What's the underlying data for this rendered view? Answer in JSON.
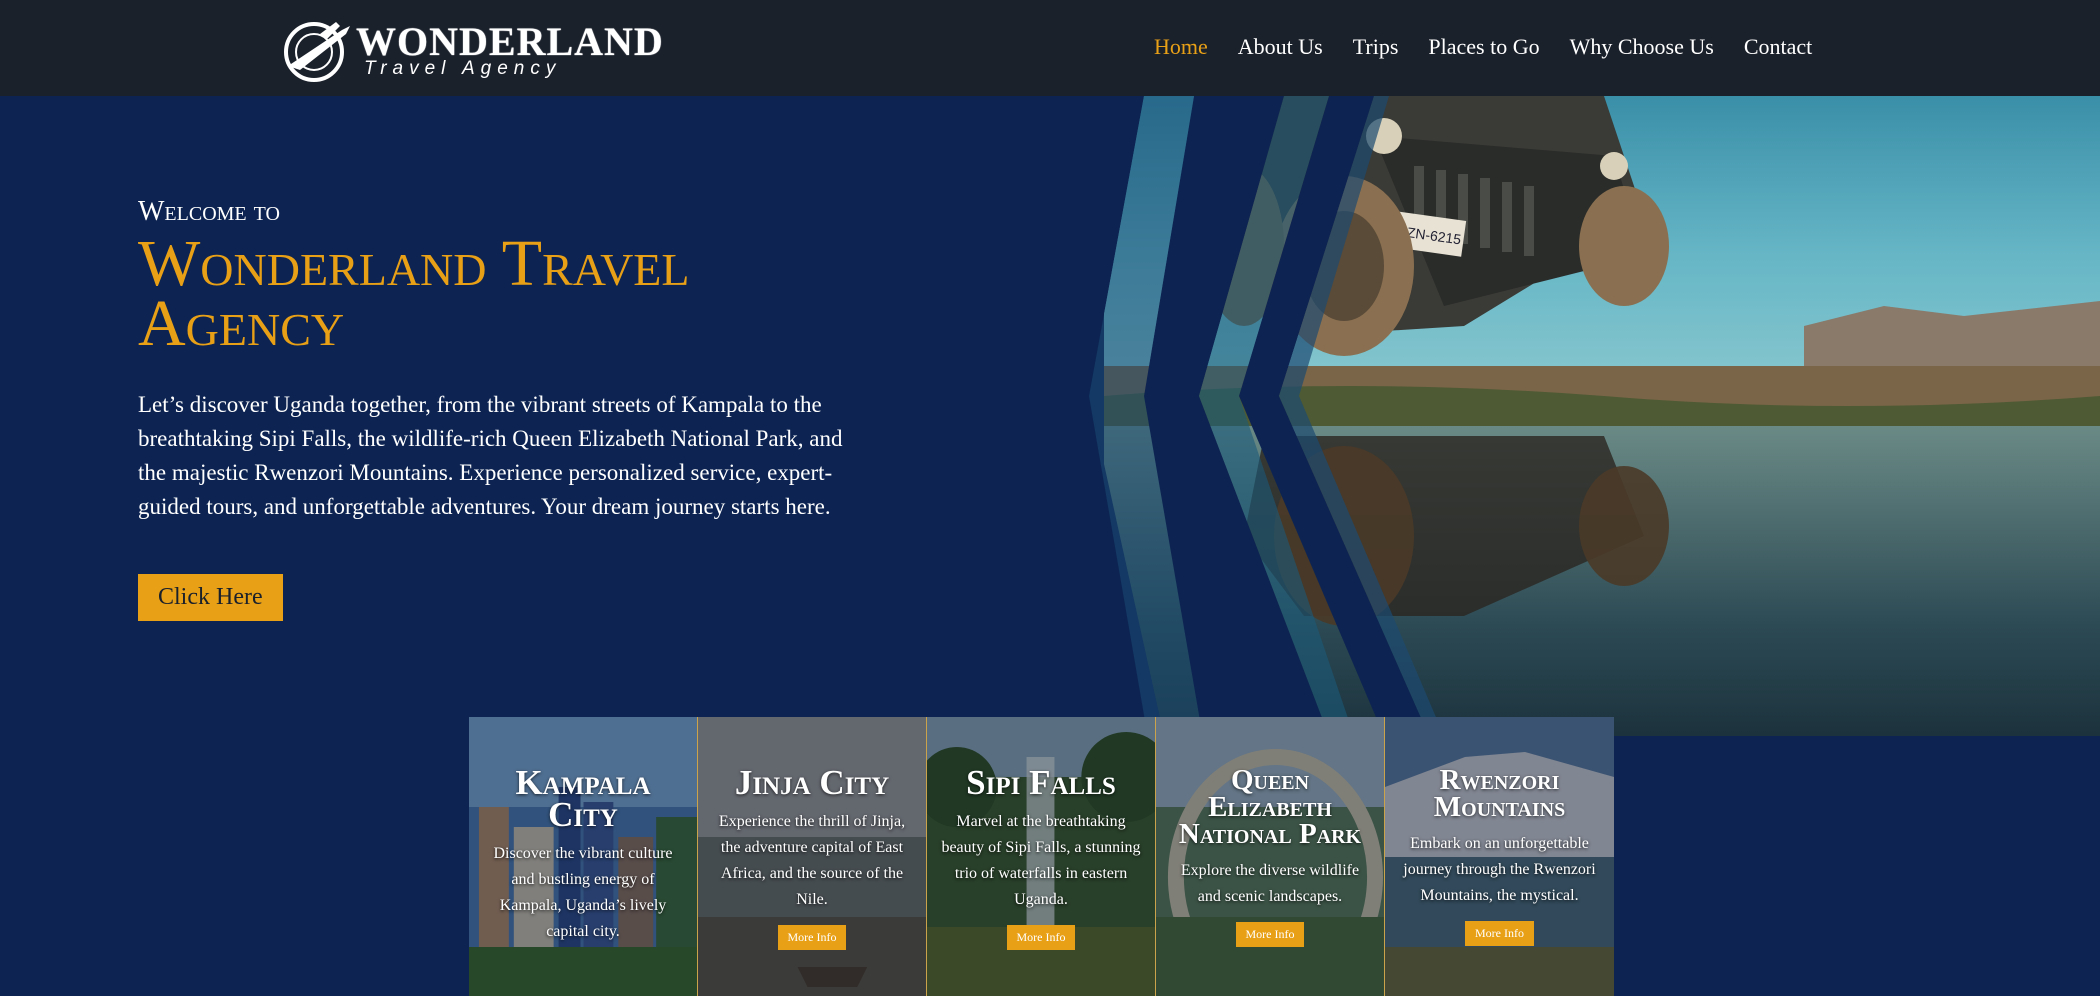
{
  "nav": {
    "logo_title": "WONDERLAND",
    "logo_subtitle": "Travel Agency",
    "menu": [
      {
        "label": "Home",
        "active": true
      },
      {
        "label": "About Us",
        "active": false
      },
      {
        "label": "Trips",
        "active": false
      },
      {
        "label": "Places to Go",
        "active": false
      },
      {
        "label": "Why Choose Us",
        "active": false
      },
      {
        "label": "Contact",
        "active": false
      }
    ]
  },
  "hero": {
    "welcome": "Welcome to",
    "title": "Wonderland Travel Agency",
    "description": "Let’s discover Uganda together, from the vibrant streets of Kampala to the breathtaking Sipi Falls, the wildlife-rich Queen Elizabeth National Park, and the majestic Rwenzori Mountains. Experience personalized service, expert-guided tours, and unforgettable adventures. Your dream journey starts here.",
    "cta_label": "Click Here",
    "plate_text": "JZN-6215"
  },
  "cards": [
    {
      "title": "Kampala City",
      "text": "Discover the vibrant culture and bustling energy of Kampala, Uganda’s lively capital city.",
      "button": ""
    },
    {
      "title": "Jinja City",
      "text": "Experience the thrill of Jinja, the adventure capital of East Africa, and the source of the Nile.",
      "button": "More Info"
    },
    {
      "title": "Sipi Falls",
      "text": "Marvel at the breathtaking beauty of Sipi Falls, a stunning trio of waterfalls in eastern Uganda.",
      "button": "More Info"
    },
    {
      "title": "Queen Elizabeth National Park",
      "text": "Explore the diverse wildlife and scenic landscapes.",
      "button": "More Info"
    },
    {
      "title": "Rwenzori Mountains",
      "text": "Embark on an unforgettable journey through the Rwenzori Mountains, the mystical.",
      "button": "More Info"
    }
  ],
  "colors": {
    "nav_bg": "#1b212b",
    "page_bg": "#0d2452",
    "accent": "#e8a017"
  }
}
